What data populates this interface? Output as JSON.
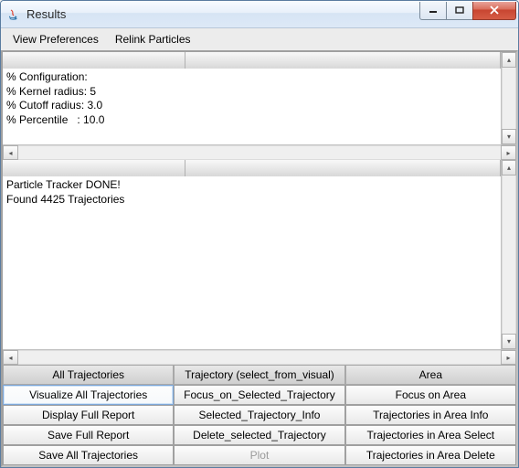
{
  "window": {
    "title": "Results"
  },
  "menu": {
    "items": [
      "View Preferences",
      "Relink Particles"
    ]
  },
  "topPane": {
    "lines": [
      "% Configuration:",
      "% Kernel radius: 5",
      "% Cutoff radius: 3.0",
      "% Percentile   : 10.0"
    ]
  },
  "bottomPane": {
    "lines": [
      "Particle Tracker DONE!",
      "Found 4425 Trajectories"
    ]
  },
  "grid": {
    "headers": [
      "All Trajectories",
      "Trajectory (select_from_visual)",
      "Area"
    ],
    "rows": [
      [
        "Visualize All Trajectories",
        "Focus_on_Selected_Trajectory",
        "Focus on Area"
      ],
      [
        "Display Full Report",
        "Selected_Trajectory_Info",
        "Trajectories in Area Info"
      ],
      [
        "Save Full Report",
        "Delete_selected_Trajectory",
        "Trajectories in Area Select"
      ],
      [
        "Save All Trajectories",
        "Plot",
        "Trajectories in Area Delete"
      ]
    ],
    "disabled": {
      "r": 3,
      "c": 1
    },
    "highlight": {
      "r": 0,
      "c": 0
    }
  }
}
